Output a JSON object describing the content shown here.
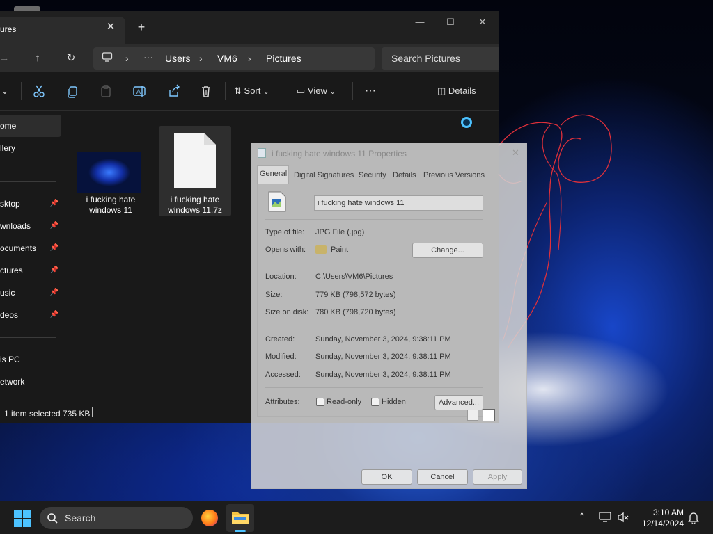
{
  "explorer": {
    "tab_title": "ures",
    "new_tab_symbol": "+",
    "breadcrumb": [
      "Users",
      "VM6",
      "Pictures"
    ],
    "search_placeholder": "Search Pictures",
    "toolbar": {
      "sort_label": "Sort",
      "view_label": "View",
      "details_label": "Details",
      "more_label": "···"
    },
    "nav_items": [
      {
        "label": "ome",
        "pinned": false
      },
      {
        "label": "llery",
        "pinned": false
      },
      {
        "label": "sktop",
        "pinned": true
      },
      {
        "label": "wnloads",
        "pinned": true
      },
      {
        "label": "ocuments",
        "pinned": true
      },
      {
        "label": "ctures",
        "pinned": true
      },
      {
        "label": "usic",
        "pinned": true
      },
      {
        "label": "deos",
        "pinned": true
      },
      {
        "label": "is PC",
        "pinned": false
      },
      {
        "label": "etwork",
        "pinned": false
      }
    ],
    "files": [
      {
        "name": "i fucking hate windows 11",
        "type": "image"
      },
      {
        "name": "i fucking hate windows 11.7z",
        "type": "document"
      }
    ],
    "status": {
      "selection": "1 item selected",
      "size": "735 KB"
    }
  },
  "properties": {
    "title": "i fucking hate windows 11 Properties",
    "tabs": [
      "General",
      "Digital Signatures",
      "Security",
      "Details",
      "Previous Versions"
    ],
    "filename": "i fucking hate windows 11",
    "rows": {
      "type_label": "Type of file:",
      "type_value": "JPG File (.jpg)",
      "opens_label": "Opens with:",
      "opens_value": "Paint",
      "change_button": "Change...",
      "location_label": "Location:",
      "location_value": "C:\\Users\\VM6\\Pictures",
      "size_label": "Size:",
      "size_value": "779 KB (798,572 bytes)",
      "disk_label": "Size on disk:",
      "disk_value": "780 KB (798,720 bytes)",
      "created_label": "Created:",
      "created_value": "Sunday, November 3, 2024, 9:38:11 PM",
      "modified_label": "Modified:",
      "modified_value": "Sunday, November 3, 2024, 9:38:11 PM",
      "accessed_label": "Accessed:",
      "accessed_value": "Sunday, November 3, 2024, 9:38:11 PM",
      "attributes_label": "Attributes:",
      "readonly_label": "Read-only",
      "hidden_label": "Hidden",
      "advanced_button": "Advanced..."
    },
    "buttons": {
      "ok": "OK",
      "cancel": "Cancel",
      "apply": "Apply"
    }
  },
  "taskbar": {
    "search_label": "Search",
    "time": "3:10 AM",
    "date": "12/14/2024"
  },
  "colors": {
    "accent": "#4cc2ff",
    "scribble": "#e0303a",
    "taskbar_bg": "#1c1c1c",
    "explorer_bg": "#191919"
  }
}
